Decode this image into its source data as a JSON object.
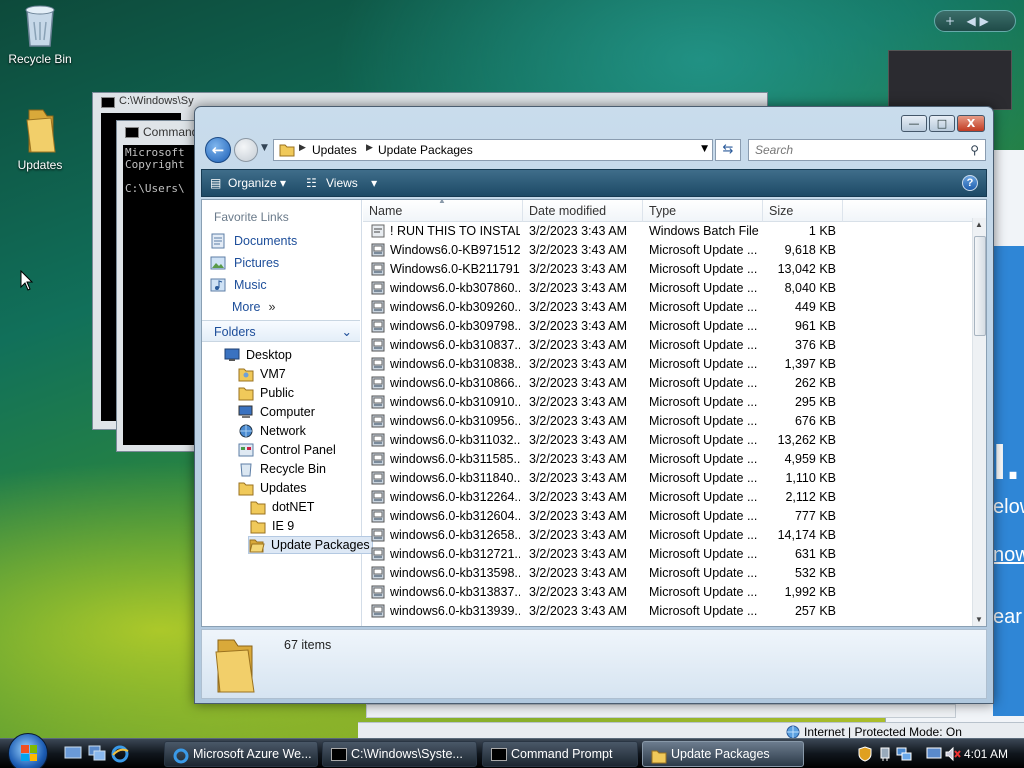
{
  "desktop": {
    "icons": [
      {
        "label": "Recycle Bin",
        "icon": "recycle-bin-icon"
      },
      {
        "label": "Updates",
        "icon": "folder-icon"
      }
    ]
  },
  "cmd_back": {
    "title": "C:\\Windows\\Sy"
  },
  "cmd_front": {
    "title": "Command",
    "lines": [
      "Microsoft",
      "Copyright",
      "",
      "C:\\Users\\"
    ]
  },
  "explorer": {
    "window_buttons": {
      "minimize": "—",
      "maximize": "□",
      "close": "X"
    },
    "breadcrumb": [
      "Updates",
      "Update Packages"
    ],
    "search_placeholder": "Search",
    "toolbar": {
      "organize": "Organize",
      "views": "Views",
      "help": "?"
    },
    "favorite_links_title": "Favorite Links",
    "favorite_links": [
      {
        "label": "Documents",
        "icon": "documents-icon"
      },
      {
        "label": "Pictures",
        "icon": "pictures-icon"
      },
      {
        "label": "Music",
        "icon": "music-icon"
      },
      {
        "label": "More",
        "icon": "chevron-right-icon"
      }
    ],
    "folders_title": "Folders",
    "tree": [
      {
        "label": "Desktop",
        "icon": "desktop-icon",
        "level": 0
      },
      {
        "label": "VM7",
        "icon": "user-folder-icon",
        "level": 1
      },
      {
        "label": "Public",
        "icon": "folder-icon",
        "level": 1
      },
      {
        "label": "Computer",
        "icon": "computer-icon",
        "level": 1
      },
      {
        "label": "Network",
        "icon": "network-icon",
        "level": 1
      },
      {
        "label": "Control Panel",
        "icon": "control-panel-icon",
        "level": 1
      },
      {
        "label": "Recycle Bin",
        "icon": "recycle-bin-icon",
        "level": 1
      },
      {
        "label": "Updates",
        "icon": "folder-icon",
        "level": 1
      },
      {
        "label": "dotNET",
        "icon": "folder-icon",
        "level": 2
      },
      {
        "label": "IE 9",
        "icon": "folder-icon",
        "level": 2
      },
      {
        "label": "Update Packages",
        "icon": "folder-open-icon",
        "level": 2,
        "selected": true
      }
    ],
    "columns": [
      "Name",
      "Date modified",
      "Type",
      "Size"
    ],
    "files": [
      {
        "name": "! RUN THIS TO INSTAL...",
        "date": "3/2/2023 3:43 AM",
        "type": "Windows Batch File",
        "size": "1 KB",
        "icon": "batch-file-icon"
      },
      {
        "name": "Windows6.0-KB971512...",
        "date": "3/2/2023 3:43 AM",
        "type": "Microsoft Update ...",
        "size": "9,618 KB",
        "icon": "update-package-icon"
      },
      {
        "name": "Windows6.0-KB211791...",
        "date": "3/2/2023 3:43 AM",
        "type": "Microsoft Update ...",
        "size": "13,042 KB",
        "icon": "update-package-icon"
      },
      {
        "name": "windows6.0-kb307860...",
        "date": "3/2/2023 3:43 AM",
        "type": "Microsoft Update ...",
        "size": "8,040 KB",
        "icon": "update-package-icon"
      },
      {
        "name": "windows6.0-kb309260...",
        "date": "3/2/2023 3:43 AM",
        "type": "Microsoft Update ...",
        "size": "449 KB",
        "icon": "update-package-icon"
      },
      {
        "name": "windows6.0-kb309798...",
        "date": "3/2/2023 3:43 AM",
        "type": "Microsoft Update ...",
        "size": "961 KB",
        "icon": "update-package-icon"
      },
      {
        "name": "windows6.0-kb310837...",
        "date": "3/2/2023 3:43 AM",
        "type": "Microsoft Update ...",
        "size": "376 KB",
        "icon": "update-package-icon"
      },
      {
        "name": "windows6.0-kb310838...",
        "date": "3/2/2023 3:43 AM",
        "type": "Microsoft Update ...",
        "size": "1,397 KB",
        "icon": "update-package-icon"
      },
      {
        "name": "windows6.0-kb310866...",
        "date": "3/2/2023 3:43 AM",
        "type": "Microsoft Update ...",
        "size": "262 KB",
        "icon": "update-package-icon"
      },
      {
        "name": "windows6.0-kb310910...",
        "date": "3/2/2023 3:43 AM",
        "type": "Microsoft Update ...",
        "size": "295 KB",
        "icon": "update-package-icon"
      },
      {
        "name": "windows6.0-kb310956...",
        "date": "3/2/2023 3:43 AM",
        "type": "Microsoft Update ...",
        "size": "676 KB",
        "icon": "update-package-icon"
      },
      {
        "name": "windows6.0-kb311032...",
        "date": "3/2/2023 3:43 AM",
        "type": "Microsoft Update ...",
        "size": "13,262 KB",
        "icon": "update-package-icon"
      },
      {
        "name": "windows6.0-kb311585...",
        "date": "3/2/2023 3:43 AM",
        "type": "Microsoft Update ...",
        "size": "4,959 KB",
        "icon": "update-package-icon"
      },
      {
        "name": "windows6.0-kb311840...",
        "date": "3/2/2023 3:43 AM",
        "type": "Microsoft Update ...",
        "size": "1,110 KB",
        "icon": "update-package-icon"
      },
      {
        "name": "windows6.0-kb312264...",
        "date": "3/2/2023 3:43 AM",
        "type": "Microsoft Update ...",
        "size": "2,112 KB",
        "icon": "update-package-icon"
      },
      {
        "name": "windows6.0-kb312604...",
        "date": "3/2/2023 3:43 AM",
        "type": "Microsoft Update ...",
        "size": "777 KB",
        "icon": "update-package-icon"
      },
      {
        "name": "windows6.0-kb312658...",
        "date": "3/2/2023 3:43 AM",
        "type": "Microsoft Update ...",
        "size": "14,174 KB",
        "icon": "update-package-icon"
      },
      {
        "name": "windows6.0-kb312721...",
        "date": "3/2/2023 3:43 AM",
        "type": "Microsoft Update ...",
        "size": "631 KB",
        "icon": "update-package-icon"
      },
      {
        "name": "windows6.0-kb313598...",
        "date": "3/2/2023 3:43 AM",
        "type": "Microsoft Update ...",
        "size": "532 KB",
        "icon": "update-package-icon"
      },
      {
        "name": "windows6.0-kb313837...",
        "date": "3/2/2023 3:43 AM",
        "type": "Microsoft Update ...",
        "size": "1,992 KB",
        "icon": "update-package-icon"
      },
      {
        "name": "windows6.0-kb313939...",
        "date": "3/2/2023 3:43 AM",
        "type": "Microsoft Update ...",
        "size": "257 KB",
        "icon": "update-package-icon"
      }
    ],
    "item_count": "67 items"
  },
  "ie_background": {
    "status_zone": "Internet | Protected Mode: On",
    "text_fragments": [
      "l.",
      "elow",
      "now",
      "ear"
    ]
  },
  "taskbar": {
    "quick_launch": [
      "show-desktop-icon",
      "switch-windows-icon",
      "internet-explorer-icon"
    ],
    "tasks": [
      {
        "label": "Microsoft Azure We...",
        "icon": "internet-explorer-icon",
        "active": false
      },
      {
        "label": "C:\\Windows\\Syste...",
        "icon": "cmd-icon",
        "active": false
      },
      {
        "label": "Command Prompt",
        "icon": "cmd-icon",
        "active": false
      },
      {
        "label": "Update Packages",
        "icon": "folder-icon",
        "active": true
      }
    ],
    "tray_icons": [
      "security-shield-icon",
      "safely-remove-icon",
      "network-tray-icon",
      "monitor-icon",
      "volume-muted-icon"
    ],
    "clock": "4:01 AM"
  },
  "colors": {
    "link_blue": "#1d4e9a",
    "toolbar_blue": "#1d4a66",
    "ie_blue": "#2f86d6"
  }
}
